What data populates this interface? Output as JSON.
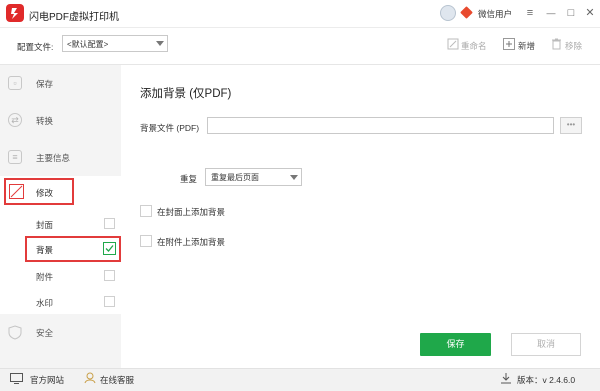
{
  "app": {
    "title": "闪电PDF虚拟打印机",
    "user_name": "微信用户"
  },
  "window_controls": {
    "menu": "≡",
    "minimize": "—",
    "maximize": "□",
    "close": "✕"
  },
  "icons": {
    "logo": "pdf-logo-icon",
    "avatar": "user-avatar-icon",
    "vip": "vip-diamond-icon"
  },
  "config": {
    "label": "配置文件:",
    "selected": "<默认配置>"
  },
  "toolbar": {
    "rename": "重命名",
    "new": "新增",
    "remove": "移除"
  },
  "sidebar": {
    "items": [
      {
        "label": "保存",
        "icon": "save-icon"
      },
      {
        "label": "转换",
        "icon": "convert-icon"
      },
      {
        "label": "主要信息",
        "icon": "info-icon"
      },
      {
        "label": "修改",
        "icon": "edit-icon",
        "active": true
      },
      {
        "label": "安全",
        "icon": "shield-icon"
      }
    ],
    "sub_items": [
      {
        "label": "封面",
        "checked": false
      },
      {
        "label": "背景",
        "checked": true,
        "selected": true
      },
      {
        "label": "附件",
        "checked": false
      },
      {
        "label": "水印",
        "checked": false
      }
    ]
  },
  "panel": {
    "title": "添加背景 (仅PDF)",
    "bg_file_label": "背景文件 (PDF)",
    "bg_file_value": "",
    "browse_label": "•••",
    "repeat_label": "重复",
    "repeat_value": "重复最后页面",
    "cover_checkbox_label": "在封面上添加背景",
    "attachment_checkbox_label": "在附件上添加背景",
    "save_label": "保存",
    "cancel_label": "取消"
  },
  "statusbar": {
    "website": "官方网站",
    "support": "在线客服",
    "version": "版本：v 2.4.6.0"
  },
  "colors": {
    "accent_green": "#1fa84a",
    "highlight_red": "#e23b3b",
    "logo_red": "#e02a2a"
  }
}
